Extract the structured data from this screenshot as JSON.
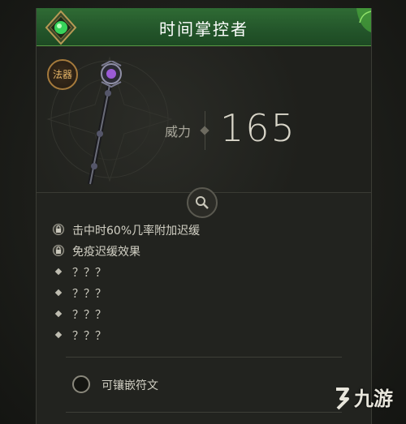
{
  "item": {
    "name": "时间掌控者",
    "type_badge": "法器",
    "power_label": "威力",
    "power_value": "165"
  },
  "affixes": [
    {
      "icon": "lock-icon",
      "text": "击中时60%几率附加迟缓"
    },
    {
      "icon": "lock-icon",
      "text": "免疫迟缓效果"
    },
    {
      "icon": "diamond-bullet-icon",
      "text": "？？？"
    },
    {
      "icon": "diamond-bullet-icon",
      "text": "？？？"
    },
    {
      "icon": "diamond-bullet-icon",
      "text": "？？？"
    },
    {
      "icon": "diamond-bullet-icon",
      "text": "？？？"
    }
  ],
  "socket": {
    "label": "可镶嵌符文"
  },
  "watermark": {
    "text": "九游"
  },
  "colors": {
    "title_bar": "#23552a",
    "gem": "#38d35a",
    "badge_gold": "#e3b366",
    "panel": "#22231f"
  }
}
